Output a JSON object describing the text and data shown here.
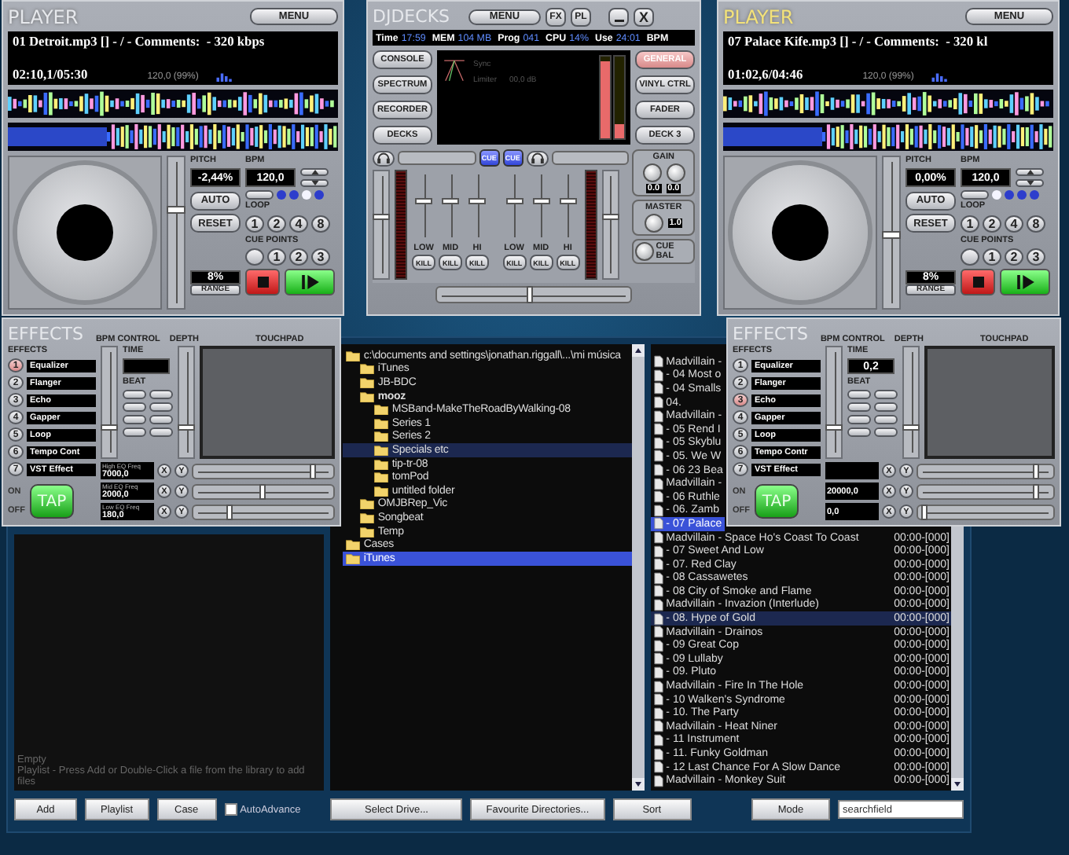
{
  "players": [
    {
      "title": "PLAYER",
      "active": false,
      "menu": "MENU",
      "track": "01 Detroit.mp3 [] - / - Comments:  - 320 kbps",
      "time": "02:10,1/05:30",
      "bpm_reading": "120,0 (99%)",
      "pitch_label": "PITCH",
      "bpm_label": "BPM",
      "pitch": "-2,44%",
      "bpm": "120,0",
      "pitch_slider": {
        "level": 0.68
      },
      "beat_dots": [
        {
          "on": false
        },
        {
          "on": false
        },
        {
          "on": true
        },
        {
          "on": false
        }
      ],
      "auto": "AUTO",
      "reset": "RESET",
      "loop_label": "LOOP",
      "loops": [
        "1",
        "2",
        "4",
        "8"
      ],
      "cue_label": "CUE POINTS",
      "cues": [
        "1",
        "2",
        "3"
      ],
      "range": "8%",
      "range_label": "RANGE"
    },
    {
      "title": "PLAYER",
      "active": true,
      "menu": "MENU",
      "track": "07 Palace Kife.mp3 [] - / - Comments:  - 320 kl",
      "time": "01:02,6/04:46",
      "bpm_reading": "120,0 (99%)",
      "pitch_label": "PITCH",
      "bpm_label": "BPM",
      "pitch": "0,00%",
      "bpm": "120,0",
      "pitch_slider": {
        "level": 0.5
      },
      "beat_dots": [
        {
          "on": true
        },
        {
          "on": false
        },
        {
          "on": false
        },
        {
          "on": false
        }
      ],
      "auto": "AUTO",
      "reset": "RESET",
      "loop_label": "LOOP",
      "loops": [
        "1",
        "2",
        "4",
        "8"
      ],
      "cue_label": "CUE POINTS",
      "cues": [
        "1",
        "2",
        "3"
      ],
      "range": "8%",
      "range_label": "RANGE"
    }
  ],
  "mixer": {
    "title": "DJDECKS",
    "menu": "MENU",
    "fx": "FX",
    "pl": "PL",
    "close": "X",
    "status": [
      {
        "label": "Time",
        "value": "17:59"
      },
      {
        "label": "MEM",
        "value": "104 MB"
      },
      {
        "label": "Prog",
        "value": "041"
      },
      {
        "label": "CPU",
        "value": "14%"
      },
      {
        "label": "Use",
        "value": "24:01"
      },
      {
        "label": "BPM"
      }
    ],
    "left_buttons": [
      "CONSOLE",
      "SPECTRUM",
      "RECORDER",
      "DECKS"
    ],
    "right_buttons": [
      {
        "label": "GENERAL",
        "selected": true
      },
      {
        "label": "VINYL CTRL",
        "selected": false
      },
      {
        "label": "FADER",
        "selected": false
      },
      {
        "label": "DECK 3",
        "selected": false
      }
    ],
    "display": {
      "sync": "Sync",
      "limiter": "Limiter",
      "limiter_value": "00,0 dB",
      "meters": [
        {
          "level": 0.95
        },
        {
          "level": 0.18
        }
      ]
    },
    "channels": [
      {
        "cue": "CUE",
        "eq_labels": [
          "LOW",
          "MID",
          "HI"
        ],
        "kills": [
          "KILL",
          "KILL",
          "KILL"
        ]
      },
      {
        "cue": "CUE",
        "eq_labels": [
          "LOW",
          "MID",
          "HI"
        ],
        "kills": [
          "KILL",
          "KILL",
          "KILL"
        ]
      }
    ],
    "gain_label": "GAIN",
    "gain_values": [
      "0.0",
      "0.0"
    ],
    "master_label": "MASTER",
    "master_value": "1.0",
    "cue_bal": "CUE BAL",
    "crossfader": {
      "level": 0.48
    }
  },
  "effects": [
    {
      "title": "EFFECTS",
      "bpm_label": "BPM CONTROL",
      "depth_label": "DEPTH",
      "touchpad_label": "TOUCHPAD",
      "list_label": "EFFECTS",
      "items": [
        {
          "num": "1",
          "name": "Equalizer",
          "selected": true
        },
        {
          "num": "2",
          "name": "Flanger",
          "selected": false
        },
        {
          "num": "3",
          "name": "Echo",
          "selected": false
        },
        {
          "num": "4",
          "name": "Gapper",
          "selected": false
        },
        {
          "num": "5",
          "name": "Loop",
          "selected": false
        },
        {
          "num": "6",
          "name": "Tempo Cont",
          "selected": false
        },
        {
          "num": "7",
          "name": "VST Effect",
          "selected": false
        }
      ],
      "time_label": "TIME",
      "beat_label": "BEAT",
      "freqs": [
        {
          "label": "High EQ Freq",
          "value": "7000,0",
          "x": "X",
          "y": "Y",
          "level": 0.88
        },
        {
          "label": "Mid EQ Freq",
          "value": "2000,0",
          "x": "X",
          "y": "Y",
          "level": 0.5
        },
        {
          "label": "Low EQ Freq",
          "value": "180,0",
          "x": "X",
          "y": "Y",
          "level": 0.25
        }
      ],
      "on": "ON",
      "off": "OFF",
      "tap": "TAP"
    },
    {
      "title": "EFFECTS",
      "bpm_label": "BPM CONTROL",
      "depth_label": "DEPTH",
      "touchpad_label": "TOUCHPAD",
      "list_label": "EFFECTS",
      "items": [
        {
          "num": "1",
          "name": "Equalizer",
          "selected": false
        },
        {
          "num": "2",
          "name": "Flanger",
          "selected": false
        },
        {
          "num": "3",
          "name": "Echo",
          "selected": true
        },
        {
          "num": "4",
          "name": "Gapper",
          "selected": false
        },
        {
          "num": "5",
          "name": "Loop",
          "selected": false
        },
        {
          "num": "6",
          "name": "Tempo Contr",
          "selected": false
        },
        {
          "num": "7",
          "name": "VST Effect",
          "selected": false
        }
      ],
      "time_label": "TIME",
      "time": "0,2",
      "beat_label": "BEAT",
      "freqs": [
        {
          "x": "X",
          "y": "Y",
          "level": 0.9
        },
        {
          "value": "20000,0",
          "x": "X",
          "y": "Y",
          "level": 0.9
        },
        {
          "value": "0,0",
          "x": "X",
          "y": "Y",
          "level": 0.02
        }
      ],
      "on": "ON",
      "off": "OFF",
      "tap": "TAP"
    }
  ],
  "library": {
    "playlist": {
      "status": "Empty",
      "hint": "Playlist - Press Add or Double-Click a file from the library to add files"
    },
    "tree": [
      {
        "name": "c:\\documents and settings\\jonathan.riggall\\...\\mi música",
        "selected": false,
        "highlighted": false,
        "current": false,
        "children": [
          {
            "name": "iTunes",
            "selected": false,
            "highlighted": false,
            "current": false
          },
          {
            "name": "JB-BDC",
            "selected": false,
            "highlighted": false,
            "current": false
          },
          {
            "name": "mooz",
            "selected": false,
            "highlighted": false,
            "current": true,
            "children": [
              {
                "name": "MSBand-MakeTheRoadByWalking-08",
                "selected": false,
                "highlighted": false,
                "current": false
              },
              {
                "name": "Series 1",
                "selected": false,
                "highlighted": false,
                "current": false
              },
              {
                "name": "Series 2",
                "selected": false,
                "highlighted": false,
                "current": false
              },
              {
                "name": "Specials etc",
                "selected": false,
                "highlighted": true,
                "current": false
              },
              {
                "name": "tip-tr-08",
                "selected": false,
                "highlighted": false,
                "current": false
              },
              {
                "name": "tomPod",
                "selected": false,
                "highlighted": false,
                "current": false
              },
              {
                "name": "untitled folder",
                "selected": false,
                "highlighted": false,
                "current": false
              }
            ]
          },
          {
            "name": "OMJBRep_Vic",
            "selected": false,
            "highlighted": false,
            "current": false
          },
          {
            "name": "Songbeat",
            "selected": false,
            "highlighted": false,
            "current": false
          },
          {
            "name": "Temp",
            "selected": false,
            "highlighted": false,
            "current": false
          }
        ]
      },
      {
        "name": "Cases",
        "selected": false,
        "highlighted": false,
        "current": false
      },
      {
        "name": "iTunes",
        "selected": true,
        "highlighted": false,
        "current": false
      }
    ],
    "tracks": [
      {
        "name": "Madvillain -",
        "selected": false,
        "highlighted": false
      },
      {
        "name": "- 04 Most o",
        "selected": false,
        "highlighted": false
      },
      {
        "name": "- 04 Smalls",
        "selected": false,
        "highlighted": false
      },
      {
        "name": "04.",
        "selected": false,
        "highlighted": false
      },
      {
        "name": "Madvillain -",
        "selected": false,
        "highlighted": false
      },
      {
        "name": "- 05 Rend I",
        "selected": false,
        "highlighted": false
      },
      {
        "name": "- 05 Skyblu",
        "selected": false,
        "highlighted": false
      },
      {
        "name": "- 05. We W",
        "selected": false,
        "highlighted": false
      },
      {
        "name": "- 06 23 Bea",
        "selected": false,
        "highlighted": false
      },
      {
        "name": "Madvillain -",
        "selected": false,
        "highlighted": false
      },
      {
        "name": "- 06 Ruthle",
        "selected": false,
        "highlighted": false
      },
      {
        "name": "- 06. Zamb",
        "selected": false,
        "highlighted": false
      },
      {
        "name": "- 07 Palace",
        "selected": true,
        "highlighted": false
      },
      {
        "name": "Madvillain - Space Ho's Coast To Coast",
        "time": "00:00-[000]",
        "selected": false,
        "highlighted": false
      },
      {
        "name": "- 07 Sweet And Low",
        "time": "00:00-[000]",
        "selected": false,
        "highlighted": false
      },
      {
        "name": "- 07. Red Clay",
        "time": "00:00-[000]",
        "selected": false,
        "highlighted": false
      },
      {
        "name": "- 08 Cassawetes",
        "time": "00:00-[000]",
        "selected": false,
        "highlighted": false
      },
      {
        "name": "- 08 City of Smoke and Flame",
        "time": "00:00-[000]",
        "selected": false,
        "highlighted": false
      },
      {
        "name": "Madvillain - Invazion (Interlude)",
        "time": "00:00-[000]",
        "selected": false,
        "highlighted": false
      },
      {
        "name": "- 08. Hype of Gold",
        "time": "00:00-[000]",
        "selected": false,
        "highlighted": true
      },
      {
        "name": "Madvillain - Drainos",
        "time": "00:00-[000]",
        "selected": false,
        "highlighted": false
      },
      {
        "name": "- 09 Great Cop",
        "time": "00:00-[000]",
        "selected": false,
        "highlighted": false
      },
      {
        "name": "- 09 Lullaby",
        "time": "00:00-[000]",
        "selected": false,
        "highlighted": false
      },
      {
        "name": "- 09. Pluto",
        "time": "00:00-[000]",
        "selected": false,
        "highlighted": false
      },
      {
        "name": "Madvillain - Fire In The Hole",
        "time": "00:00-[000]",
        "selected": false,
        "highlighted": false
      },
      {
        "name": "- 10 Walken's Syndrome",
        "time": "00:00-[000]",
        "selected": false,
        "highlighted": false
      },
      {
        "name": "- 10. The Party",
        "time": "00:00-[000]",
        "selected": false,
        "highlighted": false
      },
      {
        "name": "Madvillain - Heat Niner",
        "time": "00:00-[000]",
        "selected": false,
        "highlighted": false
      },
      {
        "name": "- 11 Instrument",
        "time": "00:00-[000]",
        "selected": false,
        "highlighted": false
      },
      {
        "name": "- 11. Funky Goldman",
        "time": "00:00-[000]",
        "selected": false,
        "highlighted": false
      },
      {
        "name": "- 12 Last Chance For A Slow Dance",
        "time": "00:00-[000]",
        "selected": false,
        "highlighted": false
      },
      {
        "name": "Madvillain - Monkey Suit",
        "time": "00:00-[000]",
        "selected": false,
        "highlighted": false
      }
    ],
    "bottom_bar": [
      {
        "kind": "button",
        "label": "Add"
      },
      {
        "kind": "button",
        "label": "Playlist"
      },
      {
        "kind": "button",
        "label": "Case"
      },
      {
        "kind": "checkbox",
        "label": "AutoAdvance",
        "checked": false
      },
      {
        "kind": "button",
        "label": "Select Drive..."
      },
      {
        "kind": "button",
        "label": "Favourite Directories..."
      },
      {
        "kind": "button",
        "label": "Sort"
      },
      {
        "kind": "button",
        "label": "Mode"
      },
      {
        "kind": "search",
        "value": "searchfield"
      }
    ]
  }
}
